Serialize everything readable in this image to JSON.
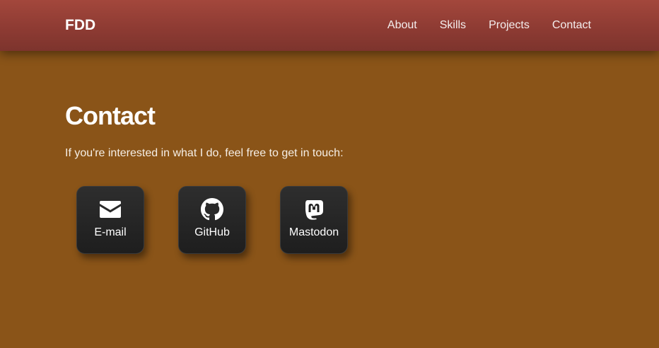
{
  "header": {
    "brand": "FDD",
    "nav": [
      {
        "label": "About"
      },
      {
        "label": "Skills"
      },
      {
        "label": "Projects"
      },
      {
        "label": "Contact"
      }
    ]
  },
  "main": {
    "title": "Contact",
    "intro": "If you're interested in what I do, feel free to get in touch:",
    "contacts": [
      {
        "label": "E-mail",
        "icon": "envelope-icon"
      },
      {
        "label": "GitHub",
        "icon": "github-icon"
      },
      {
        "label": "Mastodon",
        "icon": "mastodon-icon"
      }
    ]
  },
  "colors": {
    "header_background": "#9a433a",
    "page_background": "#8a5418",
    "card_background": "#262626",
    "text": "#ffffff"
  }
}
